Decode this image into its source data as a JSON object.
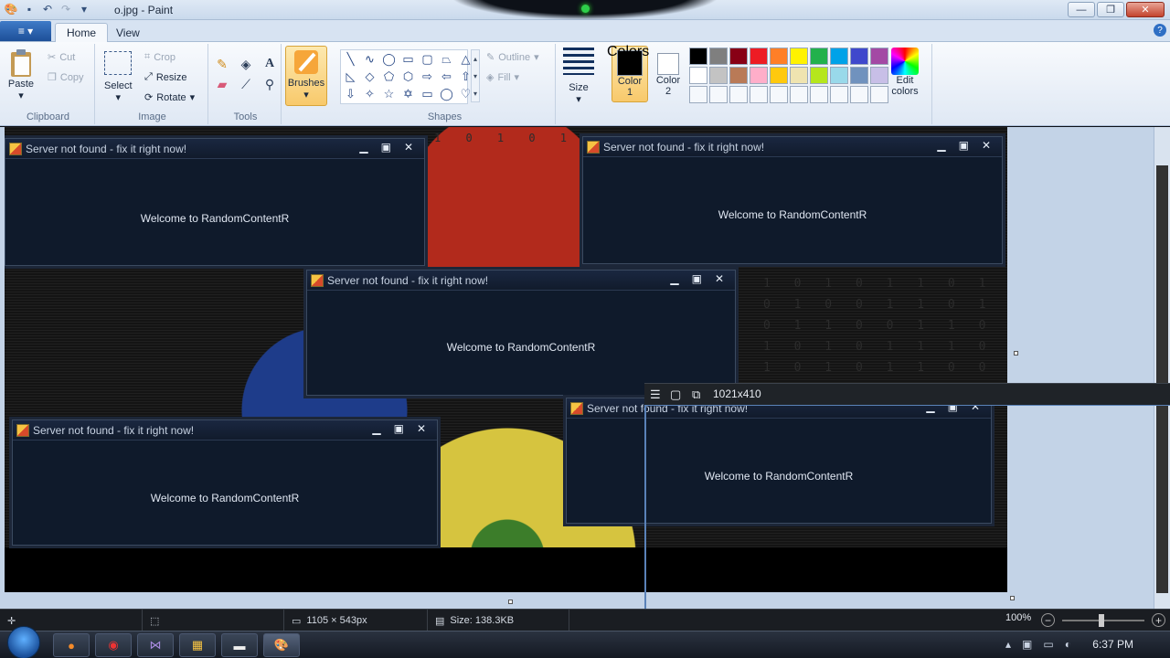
{
  "window": {
    "title": "o.jpg - Paint",
    "minimize_glyph": "—",
    "maximize_glyph": "❐",
    "close_glyph": "✕"
  },
  "tabs": {
    "file": "≡ ▾",
    "home": "Home",
    "view": "View"
  },
  "clipboard": {
    "paste": "Paste",
    "cut": "Cut",
    "copy": "Copy",
    "label": "Clipboard"
  },
  "image": {
    "select": "Select",
    "crop": "Crop",
    "resize": "Resize",
    "rotate": "Rotate",
    "label": "Image"
  },
  "tools": {
    "label": "Tools"
  },
  "brushes": {
    "label": "Brushes"
  },
  "shapes": {
    "outline": "Outline",
    "fill": "Fill",
    "label": "Shapes"
  },
  "size": {
    "label": "Size"
  },
  "colors": {
    "color1": "Color\n1",
    "color1_line1": "Color",
    "color1_line2": "1",
    "color2_line1": "Color",
    "color2_line2": "2",
    "edit_line1": "Edit",
    "edit_line2": "colors",
    "label": "Colors",
    "palette": [
      "#000000",
      "#7f7f7f",
      "#880015",
      "#ed1c24",
      "#ff7f27",
      "#fff200",
      "#22b14c",
      "#00a2e8",
      "#3f48cc",
      "#a349a4",
      "#ffffff",
      "#c3c3c3",
      "#b97a57",
      "#ffaec9",
      "#ffc90e",
      "#efe4b0",
      "#b5e61d",
      "#99d9ea",
      "#7092be",
      "#c8bfe7",
      "#f5f8fc",
      "#f5f8fc",
      "#f5f8fc",
      "#f5f8fc",
      "#f5f8fc",
      "#f5f8fc",
      "#f5f8fc",
      "#f5f8fc",
      "#f5f8fc",
      "#f5f8fc"
    ]
  },
  "dialogs": [
    {
      "title": "Server not found - fix it right now!",
      "message": "Welcome to RandomContentR"
    },
    {
      "title": "Server not found - fix it right now!",
      "message": "Welcome to RandomContentR"
    },
    {
      "title": "Server not found - fix it right now!",
      "message": "Welcome to RandomContentR"
    },
    {
      "title": "Server not found - fix it right now!",
      "message": "Welcome to RandomContentR"
    },
    {
      "title": "Server not found - fix it right now!",
      "message": "Welcome to RandomContentR"
    }
  ],
  "background_text": {
    "binary_a": "1 0 1 0 1 1 0 1 0 1 0 0 1 1 0 1 0 1 1 0 0 1 1 0 1 0 1 0 1 1 1 0 1 0 1 0 1 1 0 0 1 0 1 0 1 1 0 0 1 0 1 1 0 0 1 0 1 0 1 0 0 1 0 1 1 0 1 0",
    "binary_b": "1 0 1 0 1 0 1 0 1 0 1"
  },
  "snip": {
    "dimensions": "1021x410"
  },
  "status": {
    "image_size": "1105 × 543px",
    "file_size": "Size: 138.3KB",
    "zoom": "100%"
  },
  "taskbar": {
    "time": "6:37 PM"
  }
}
